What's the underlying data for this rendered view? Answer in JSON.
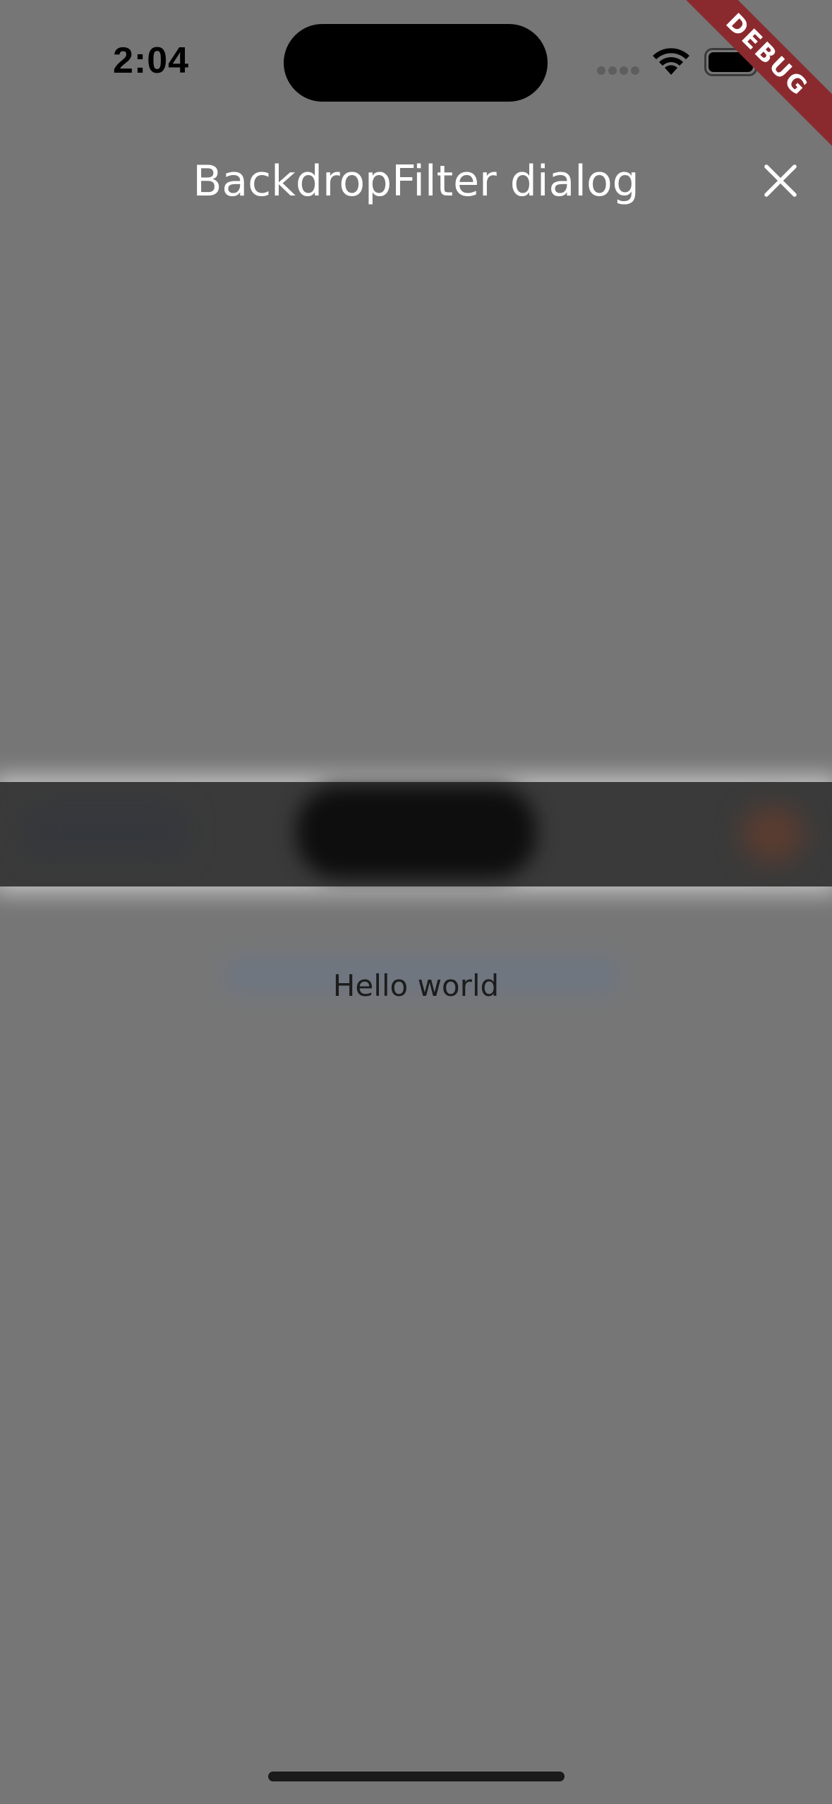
{
  "status_bar": {
    "time": "2:04"
  },
  "debug_banner": {
    "label": "DEBUG",
    "color": "#8a2a2f"
  },
  "dialog": {
    "title": "BackdropFilter dialog",
    "close_icon": "close-icon"
  },
  "content": {
    "text": "Hello world"
  },
  "colors": {
    "overlay": "#767676",
    "title_text": "#ffffff",
    "body_text": "#1c1c1c"
  }
}
